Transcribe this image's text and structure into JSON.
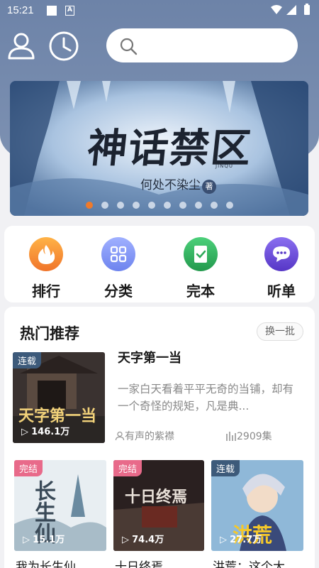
{
  "status": {
    "time": "15:21",
    "a_badge": "A"
  },
  "search": {
    "placeholder": ""
  },
  "banner": {
    "title": "神话禁区",
    "author": "何处不染尘",
    "stamp": "著",
    "sub": "JINQU",
    "slides": 10,
    "active": 0
  },
  "categories": [
    {
      "label": "排行",
      "icon": "flame-icon",
      "color": "#f5893a"
    },
    {
      "label": "分类",
      "icon": "grid-icon",
      "color": "#7b8ff0"
    },
    {
      "label": "完本",
      "icon": "book-check-icon",
      "color": "#2fa95a"
    },
    {
      "label": "听单",
      "icon": "chat-bubble-icon",
      "color": "#6a4fd6"
    }
  ],
  "recommend": {
    "title": "热门推荐",
    "swap_label": "换一批",
    "featured": {
      "tag": "连载",
      "count": "146.1万",
      "title": "天字第一当",
      "desc": "一家白天看着平平无奇的当铺，却有一个奇怪的规矩，凡是典...",
      "author": "有声的紫襟",
      "episodes": "2909集",
      "cover_text": "天字第一当"
    },
    "grid": [
      {
        "tag": "完结",
        "count": "15.1万",
        "title": "我为长生仙",
        "cover_text": "长生仙"
      },
      {
        "tag": "完结",
        "count": "74.4万",
        "title": "十日终焉",
        "cover_text": "十日终焉"
      },
      {
        "tag": "连载",
        "count": "27.7万",
        "title": "洪荒：这个大",
        "cover_text": "洪荒"
      }
    ]
  }
}
